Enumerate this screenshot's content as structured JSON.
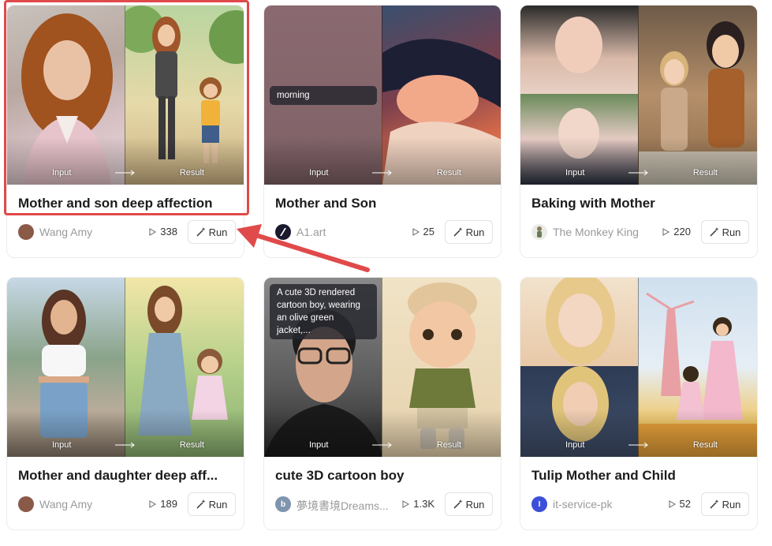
{
  "labels": {
    "input": "Input",
    "result": "Result",
    "run": "Run"
  },
  "cards": [
    {
      "title": "Mother and son deep affection",
      "author": "Wang Amy",
      "plays": "338",
      "avatar_letter": "",
      "avatar_color": "#8a5a48"
    },
    {
      "title": "Mother and Son",
      "author": "A1.art",
      "plays": "25",
      "prompt": "morning",
      "avatar_letter": "",
      "avatar_color": "#1a1a2e"
    },
    {
      "title": "Baking with Mother",
      "author": "The Monkey King",
      "plays": "220",
      "avatar_letter": "",
      "avatar_color": "#7a8a6a"
    },
    {
      "title": "Mother and daughter deep aff...",
      "author": "Wang Amy",
      "plays": "189",
      "avatar_letter": "",
      "avatar_color": "#8a5a48"
    },
    {
      "title": "cute 3D cartoon boy",
      "author": "夢境書境Dreams...",
      "plays": "1.3K",
      "prompt": "A cute 3D rendered cartoon boy, wearing an olive green jacket,...",
      "avatar_letter": "b",
      "avatar_color": "#7f95ad"
    },
    {
      "title": "Tulip Mother and Child",
      "author": "it-service-pk",
      "plays": "52",
      "avatar_letter": "I",
      "avatar_color": "#3b4fd8"
    }
  ],
  "prompt_lines": [
    "A cute 3D rendered",
    "cartoon boy, wearing",
    "an olive green jacket,..."
  ],
  "colors": {
    "highlight": "#e04a4a",
    "arrow": "#e04a4a"
  }
}
